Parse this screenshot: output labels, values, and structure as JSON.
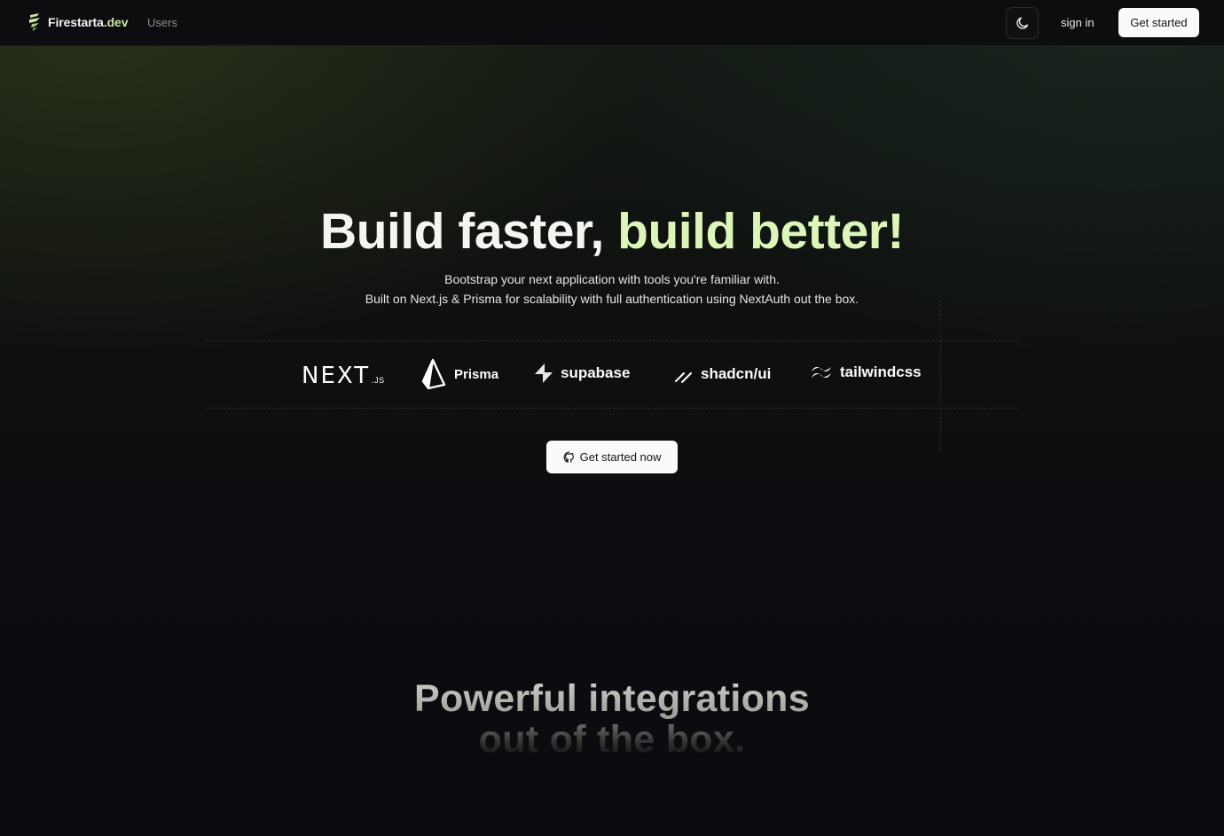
{
  "nav": {
    "brand_name": "Firestarta",
    "brand_tld": ".dev",
    "users_link": "Users",
    "theme_toggle_icon": "moon-icon",
    "sign_in": "sign in",
    "get_started": "Get started"
  },
  "hero": {
    "title_part1": "Build faster,",
    "title_part2": "build better!",
    "subtitle_line1": "Bootstrap your next application with tools you're familiar with.",
    "subtitle_line2": "Built on Next.js & Prisma for scalability with full authentication using NextAuth out the box.",
    "cta_label": "Get started now",
    "cta_icon": "github-icon"
  },
  "tech_stack": [
    {
      "name": "nextjs",
      "label": "NEXT",
      "suffix": ".JS"
    },
    {
      "name": "prisma",
      "label": "Prisma"
    },
    {
      "name": "supabase",
      "label": "supabase"
    },
    {
      "name": "shadcn",
      "label": "shadcn/ui"
    },
    {
      "name": "tailwindcss",
      "label": "tailwindcss"
    }
  ],
  "section": {
    "title_line1": "Powerful integrations",
    "title_line2": "out of the box."
  },
  "colors": {
    "accent": "#dcf5b8",
    "brand_accent": "#c9e8a6",
    "background": "#0b0c0f",
    "button_bg": "#fafafa"
  }
}
